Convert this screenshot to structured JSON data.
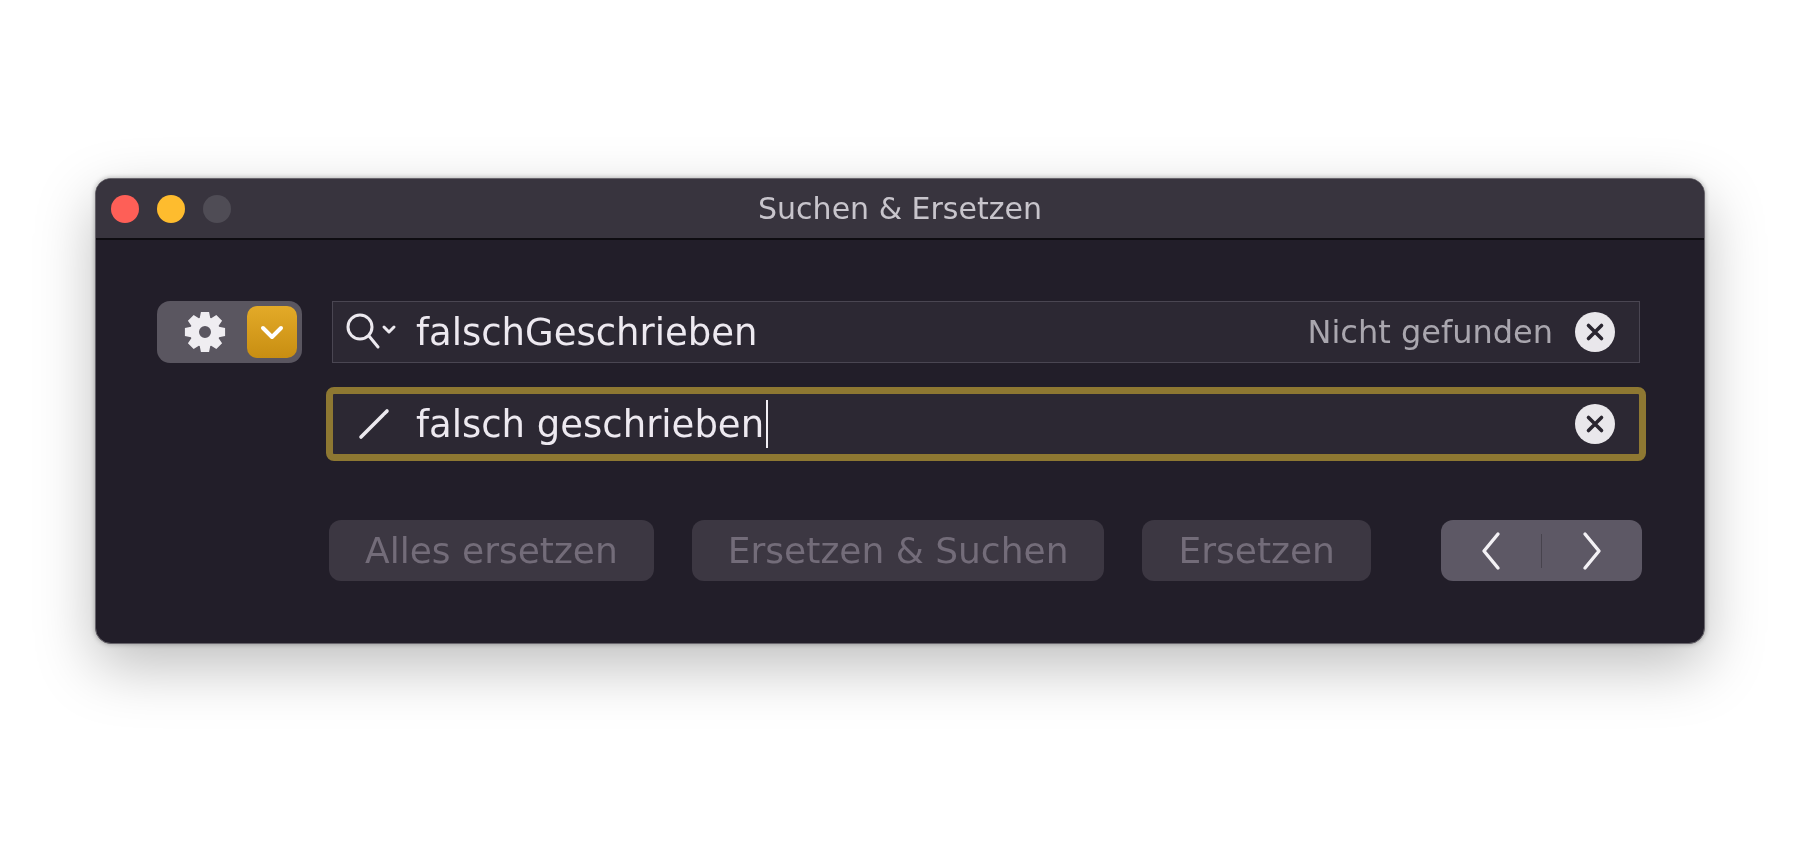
{
  "window": {
    "title": "Suchen & Ersetzen",
    "controls": [
      {
        "kind": "close",
        "disabled": false
      },
      {
        "kind": "minimize",
        "disabled": false
      },
      {
        "kind": "zoom",
        "disabled": true
      }
    ]
  },
  "search": {
    "value": "falschGeschrieben",
    "status": "Nicht gefunden",
    "focused": false
  },
  "replace": {
    "value": "falsch geschrieben",
    "focused": true
  },
  "buttons": [
    {
      "label": "Alles ersetzen",
      "disabled": true
    },
    {
      "label": "Ersetzen & Suchen",
      "disabled": true
    },
    {
      "label": "Ersetzen",
      "disabled": true
    }
  ]
}
